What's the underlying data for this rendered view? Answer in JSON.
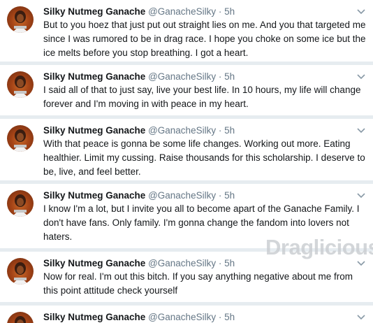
{
  "author": {
    "name": "Silky Nutmeg Ganache",
    "handle": "@GanacheSilky",
    "dot": "·",
    "avatar_icon": "profile-avatar"
  },
  "tweets": [
    {
      "time": "5h",
      "text": "But to you hoez that just put out straight lies on me. And you that targeted me since I was rumored to be in drag race. I hope you choke on some ice but the ice melts before you stop breathing. I got a heart."
    },
    {
      "time": "5h",
      "text": "I said all of that to just say, live your best life. In 10 hours, my life will change forever and I'm moving in with peace in my heart."
    },
    {
      "time": "5h",
      "text": "With that peace is gonna be some life changes. Working out more. Eating healthier. Limit my cussing. Raise thousands for this scholarship. I deserve to be, live, and feel better."
    },
    {
      "time": "5h",
      "text": "I know I'm a lot, but I invite you all to become apart of the Ganache Family. I don't have fans. Only family. I'm gonna change the fandom into lovers not haters."
    },
    {
      "time": "5h",
      "text": "Now for real. I'm out this bitch. If you say anything negative about me from this point attitude check yourself"
    },
    {
      "time": "5h",
      "text": ""
    }
  ],
  "watermark": "Draglicious",
  "colors": {
    "divider": "#e6ecf0",
    "secondary_text": "#657786",
    "primary_text": "#14171a"
  },
  "icons": {
    "caret": "chevron-down-icon"
  }
}
